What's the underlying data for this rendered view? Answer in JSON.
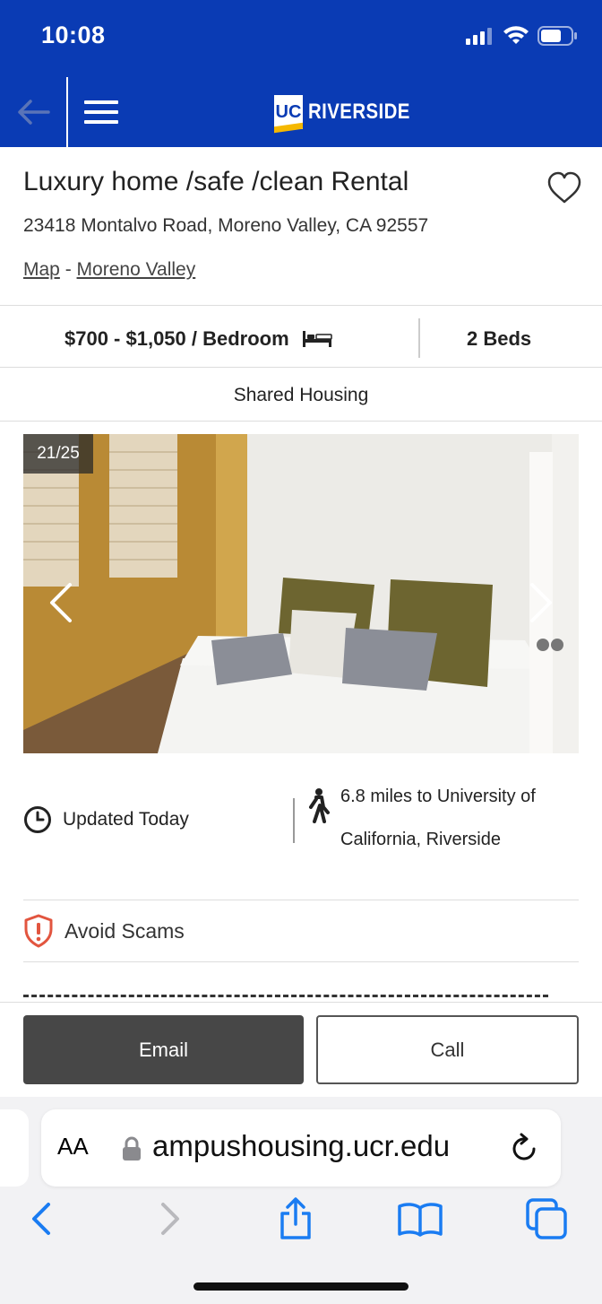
{
  "status_bar": {
    "time": "10:08"
  },
  "header": {
    "brand_mark": "UC",
    "brand_name": "RIVERSIDE"
  },
  "listing": {
    "title": "Luxury home /safe /clean Rental",
    "address": "23418 Montalvo Road, Moreno Valley, CA 92557",
    "map_link": "Map",
    "separator": "-",
    "city_link": "Moreno Valley",
    "price": "$700 - $1,050 / Bedroom",
    "beds": "2 Beds",
    "housing_type": "Shared Housing",
    "photo_counter": "21/25",
    "updated": "Updated Today",
    "distance": "6.8 miles to University of California, Riverside",
    "avoid_scams": "Avoid Scams"
  },
  "actions": {
    "email_label": "Email",
    "call_label": "Call"
  },
  "browser": {
    "text_size_label": "AA",
    "url": "ampushousing.ucr.edu"
  },
  "colors": {
    "brand_blue": "#0a3bb4",
    "email_button": "#474747",
    "scam_red": "#e2553f",
    "browser_blue": "#1a7cf2"
  },
  "icons": [
    "back-arrow-icon",
    "menu-icon",
    "heart-icon",
    "bed-icon",
    "clock-icon",
    "walking-person-icon",
    "shield-alert-icon",
    "lock-icon",
    "reload-icon",
    "share-icon",
    "bookmarks-icon",
    "tabs-icon"
  ]
}
